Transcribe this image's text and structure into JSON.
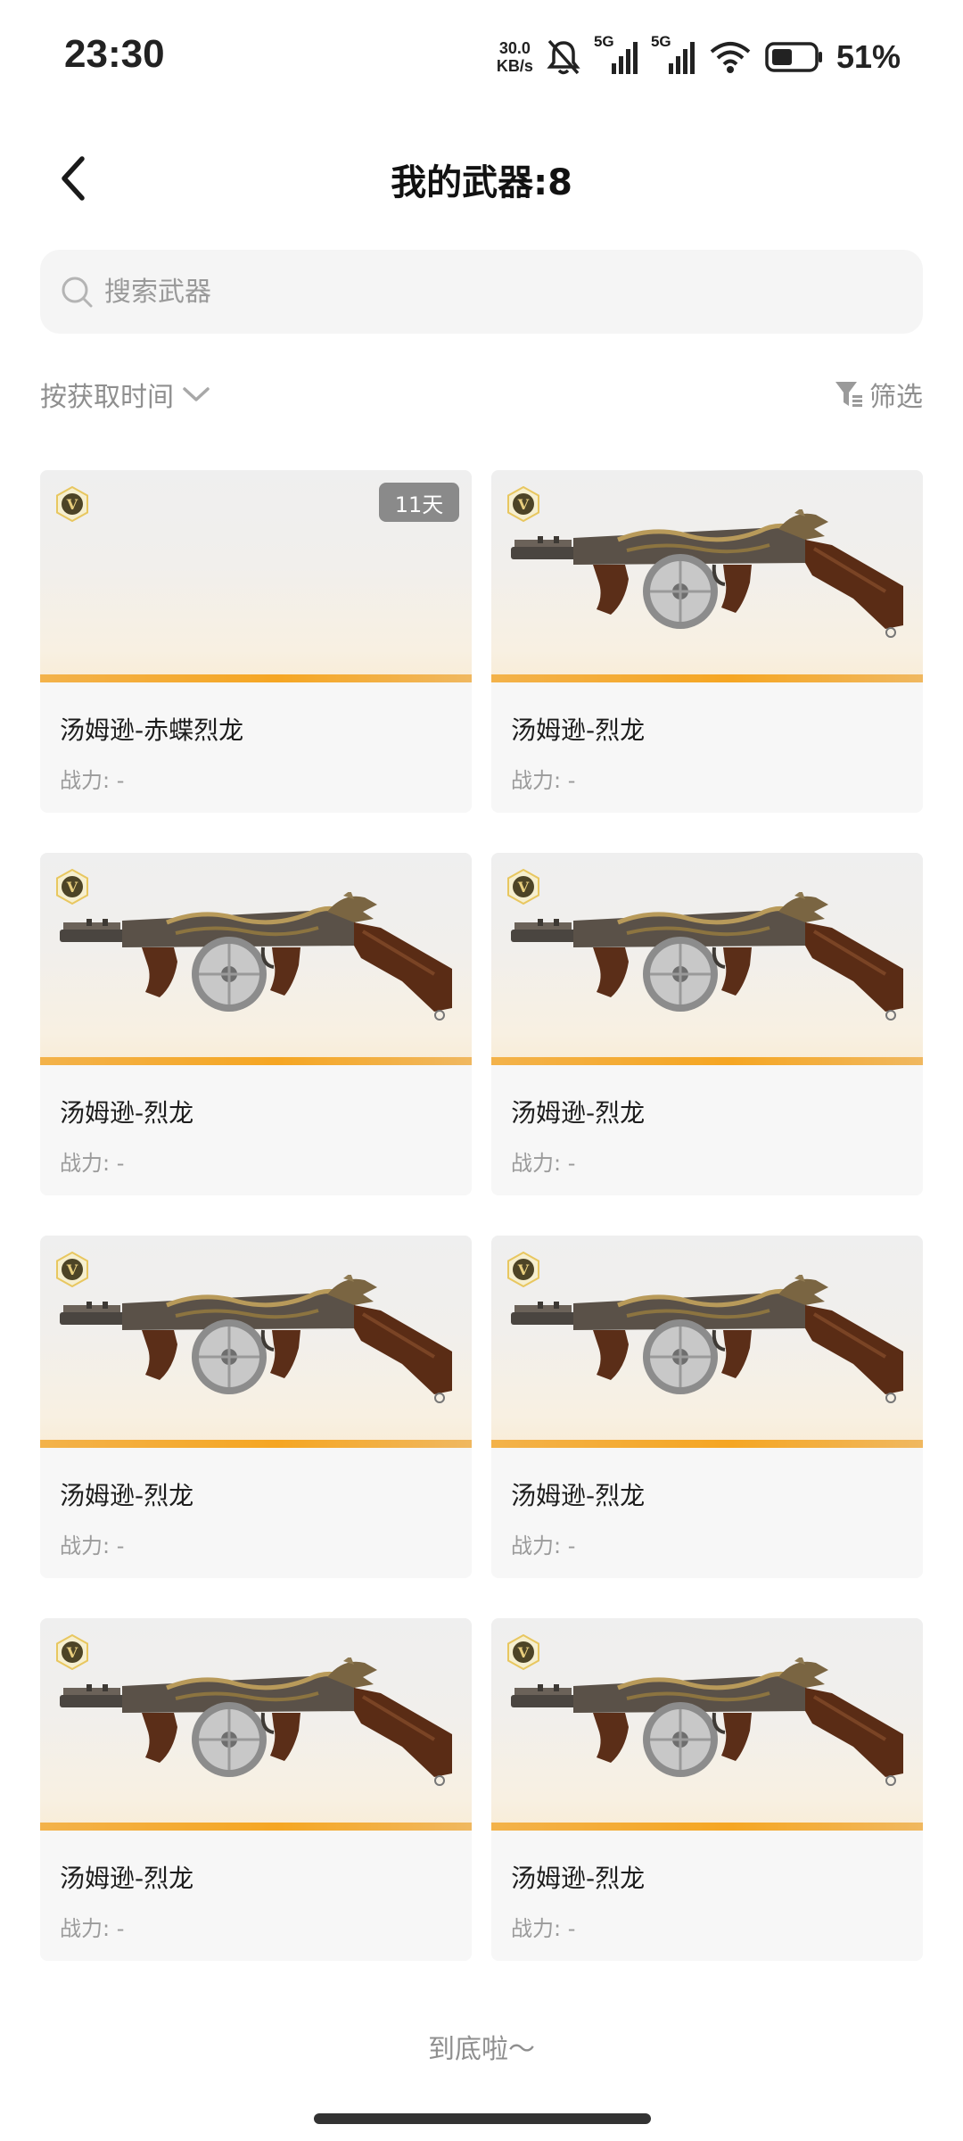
{
  "status_bar": {
    "time": "23:30",
    "net_speed_value": "30.0",
    "net_speed_unit": "KB/s",
    "signal1_label": "5G",
    "signal2_label": "5G",
    "battery_percent": "51%",
    "battery_level": 0.51
  },
  "header": {
    "title": "我的武器:8"
  },
  "search": {
    "placeholder": "搜索武器"
  },
  "toolbar": {
    "sort_label": "按获取时间",
    "filter_label": "筛选"
  },
  "weapons": [
    {
      "name": "汤姆逊-赤蝶烈龙",
      "power": "战力: -",
      "days_left": "11天",
      "has_image": false,
      "tier_badge": "V"
    },
    {
      "name": "汤姆逊-烈龙",
      "power": "战力: -",
      "has_image": true,
      "tier_badge": "V"
    },
    {
      "name": "汤姆逊-烈龙",
      "power": "战力: -",
      "has_image": true,
      "tier_badge": "V"
    },
    {
      "name": "汤姆逊-烈龙",
      "power": "战力: -",
      "has_image": true,
      "tier_badge": "V"
    },
    {
      "name": "汤姆逊-烈龙",
      "power": "战力: -",
      "has_image": true,
      "tier_badge": "V"
    },
    {
      "name": "汤姆逊-烈龙",
      "power": "战力: -",
      "has_image": true,
      "tier_badge": "V"
    },
    {
      "name": "汤姆逊-烈龙",
      "power": "战力: -",
      "has_image": true,
      "tier_badge": "V"
    },
    {
      "name": "汤姆逊-烈龙",
      "power": "战力: -",
      "has_image": true,
      "tier_badge": "V"
    }
  ],
  "footer": {
    "end_text": "到底啦～"
  },
  "colors": {
    "accent_orange": "#f5a623",
    "card_bg": "#f7f7f7",
    "muted_text": "#9b9b9b",
    "badge_gray": "#8a8a8a"
  },
  "icons": {
    "back": "chevron-left-icon",
    "search": "search-icon",
    "sort": "chevron-down-icon",
    "filter": "filter-icon",
    "tier": "v-tier-badge-icon"
  }
}
